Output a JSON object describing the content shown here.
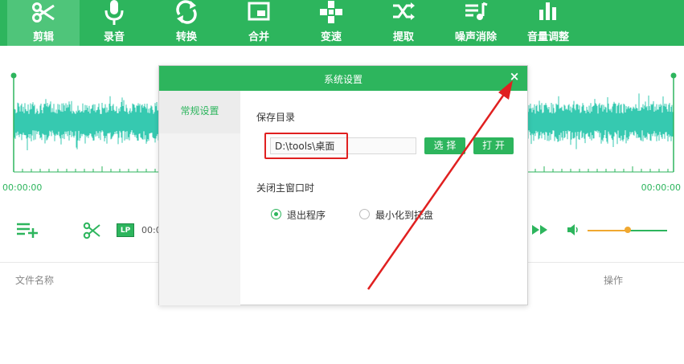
{
  "toolbar": {
    "items": [
      {
        "label": "剪辑",
        "icon": "scissors-icon",
        "active": true
      },
      {
        "label": "录音",
        "icon": "microphone-icon"
      },
      {
        "label": "转换",
        "icon": "convert-icon"
      },
      {
        "label": "合并",
        "icon": "merge-icon"
      },
      {
        "label": "变速",
        "icon": "speed-icon"
      },
      {
        "label": "提取",
        "icon": "extract-icon"
      },
      {
        "label": "噪声消除",
        "icon": "noise-removal-icon"
      },
      {
        "label": "音量调整",
        "icon": "volume-bars-icon"
      }
    ]
  },
  "waveform": {
    "start_time": "00:00:00",
    "end_time": "00:00:00",
    "color": "#36c9b0"
  },
  "controls": {
    "lp_label": "LP",
    "time_partial": "00:0",
    "volume_level": 0.5
  },
  "file_list": {
    "col_name": "文件名称",
    "col_ops": "操作"
  },
  "dialog": {
    "title": "系统设置",
    "close_glyph": "×",
    "sidebar": [
      {
        "label": "常规设置"
      }
    ],
    "save_dir_label": "保存目录",
    "save_path": "D:\\tools\\桌面",
    "choose_button": "选 择",
    "open_button": "打 开",
    "close_main_label": "关闭主窗口时",
    "radio_options": [
      {
        "label": "退出程序",
        "checked": true
      },
      {
        "label": "最小化到托盘",
        "checked": false
      }
    ]
  },
  "colors": {
    "brand_green": "#2db55d",
    "annotation_red": "#e02020",
    "volume_orange": "#f0a830"
  }
}
